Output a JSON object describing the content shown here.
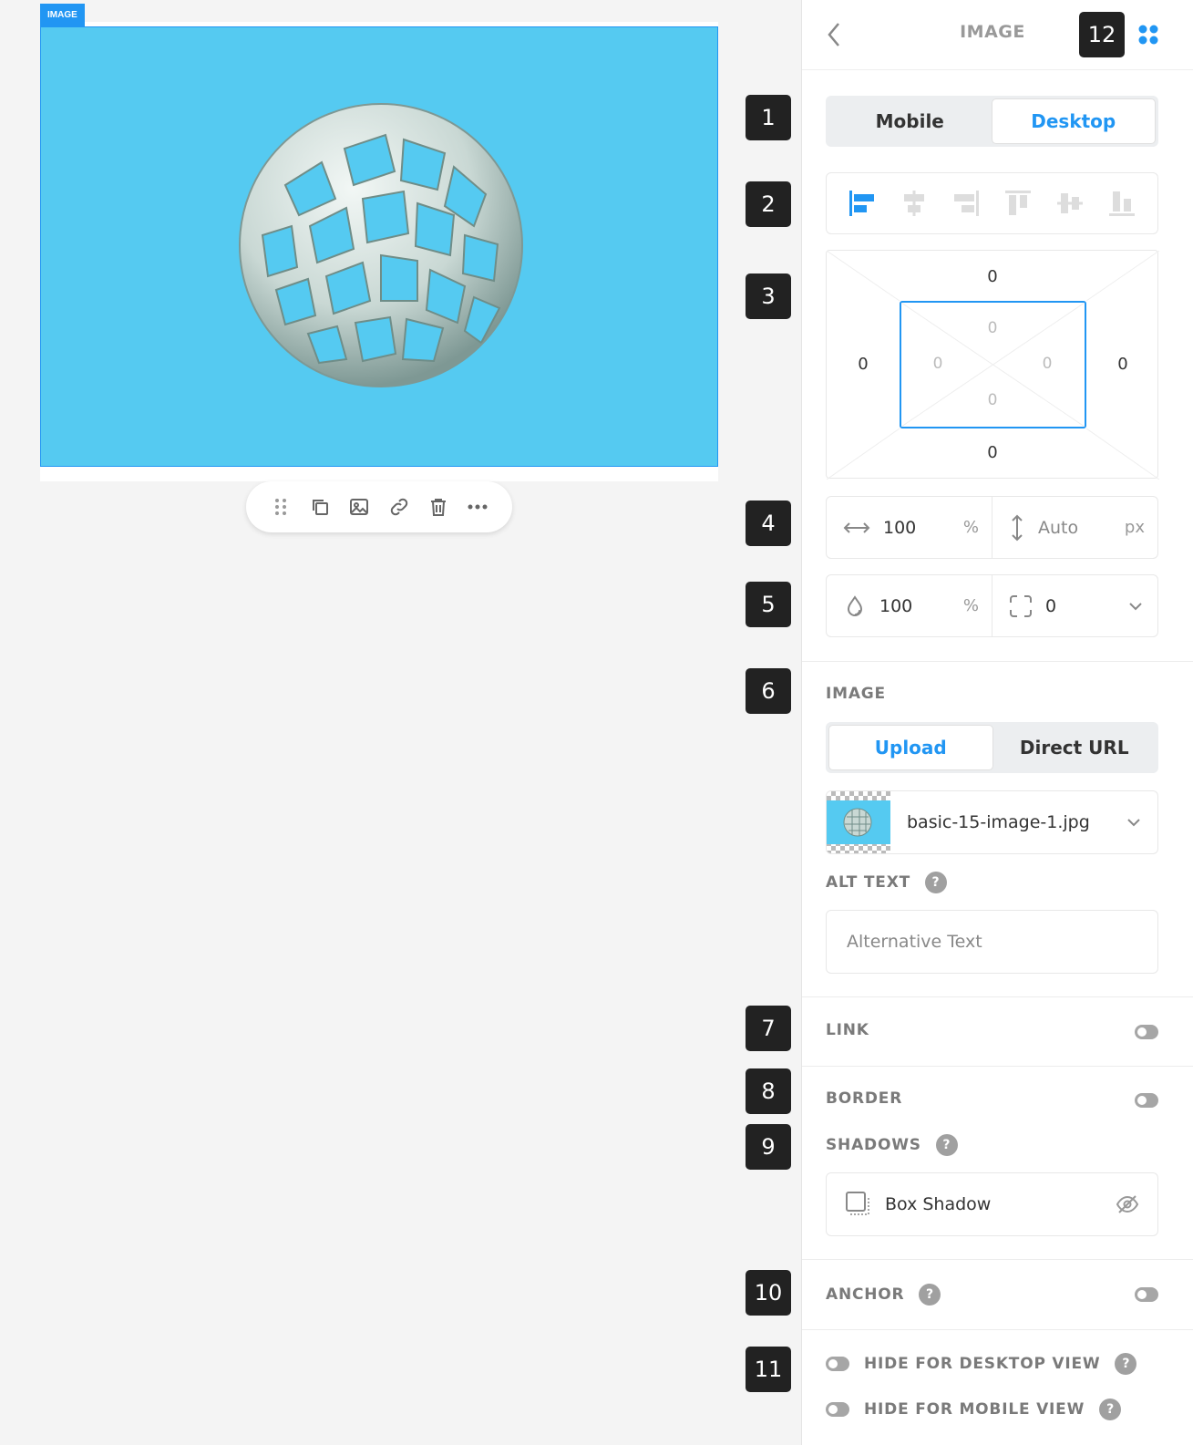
{
  "canvas": {
    "tag_label": "IMAGE",
    "image_bg": "#55caf1",
    "accent": "#2196f3"
  },
  "toolbar": {
    "items": [
      {
        "name": "drag-handle-icon"
      },
      {
        "name": "duplicate-icon"
      },
      {
        "name": "image-icon"
      },
      {
        "name": "link-icon"
      },
      {
        "name": "delete-icon"
      },
      {
        "name": "more-icon"
      }
    ]
  },
  "callouts": [
    "1",
    "2",
    "3",
    "4",
    "5",
    "6",
    "7",
    "8",
    "9",
    "10",
    "11",
    "12"
  ],
  "panel": {
    "title": "IMAGE",
    "device_tabs": {
      "mobile": "Mobile",
      "desktop": "Desktop",
      "active": "desktop"
    },
    "alignment": {
      "options": [
        "align-left",
        "align-center-h",
        "align-right",
        "align-top",
        "align-middle",
        "align-bottom"
      ],
      "active": "align-left"
    },
    "box_model": {
      "margin": {
        "top": "0",
        "right": "0",
        "bottom": "0",
        "left": "0"
      },
      "padding": {
        "top": "0",
        "right": "0",
        "bottom": "0",
        "left": "0"
      }
    },
    "size": {
      "width": "100",
      "width_unit": "%",
      "height": "Auto",
      "height_unit": "px"
    },
    "appearance": {
      "opacity": "100",
      "opacity_unit": "%",
      "radius": "0"
    },
    "image_section": {
      "label": "IMAGE",
      "source_tabs": {
        "upload": "Upload",
        "direct_url": "Direct URL",
        "active": "upload"
      },
      "file_name": "basic-15-image-1.jpg",
      "alt_label": "ALT TEXT",
      "alt_placeholder": "Alternative Text",
      "alt_value": ""
    },
    "link": {
      "label": "LINK",
      "enabled": false
    },
    "border": {
      "label": "BORDER",
      "enabled": false
    },
    "shadows": {
      "label": "SHADOWS",
      "item_label": "Box Shadow",
      "visible": false
    },
    "anchor": {
      "label": "ANCHOR",
      "enabled": false
    },
    "visibility": {
      "hide_desktop_label": "HIDE FOR DESKTOP VIEW",
      "hide_mobile_label": "HIDE FOR MOBILE VIEW",
      "hide_desktop": false,
      "hide_mobile": false
    },
    "help_glyph": "?"
  }
}
